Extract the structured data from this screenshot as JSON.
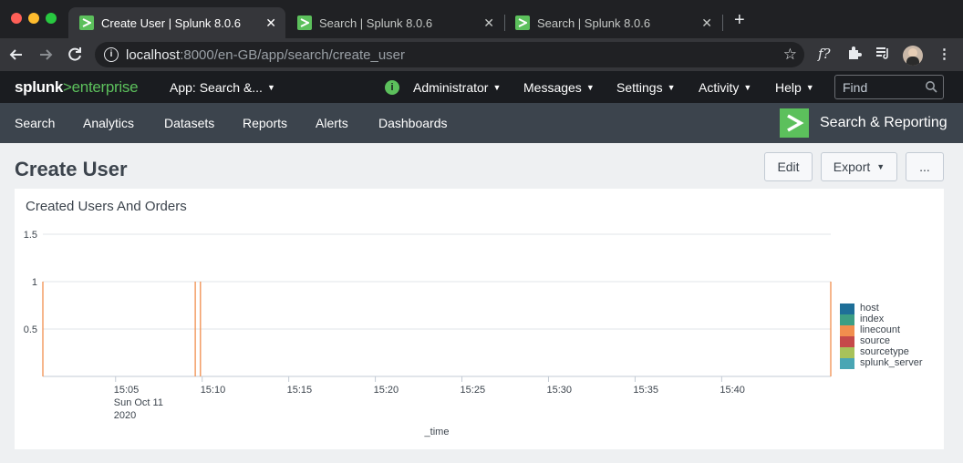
{
  "browser": {
    "tabs": [
      {
        "title": "Create User | Splunk 8.0.6",
        "active": true
      },
      {
        "title": "Search | Splunk 8.0.6",
        "active": false
      },
      {
        "title": "Search | Splunk 8.0.6",
        "active": false
      }
    ],
    "url_host": "localhost",
    "url_path": ":8000/en-GB/app/search/create_user"
  },
  "splunkbar": {
    "logo_main": "splunk",
    "logo_gt": ">",
    "logo_sub": "enterprise",
    "app_menu": "App: Search &...",
    "user_menu": "Administrator",
    "messages": "Messages",
    "settings": "Settings",
    "activity": "Activity",
    "help": "Help",
    "find_placeholder": "Find"
  },
  "appbar": {
    "nav": [
      "Search",
      "Analytics",
      "Datasets",
      "Reports",
      "Alerts",
      "Dashboards"
    ],
    "app_title": "Search & Reporting"
  },
  "page": {
    "title": "Create User",
    "edit_label": "Edit",
    "export_label": "Export",
    "more_label": "..."
  },
  "panel": {
    "title": "Created Users And Orders"
  },
  "chart_data": {
    "type": "line",
    "title": "Created Users And Orders",
    "xlabel": "_time",
    "ylabel": "",
    "ylim": [
      0,
      1.5
    ],
    "yticks": [
      0.5,
      1,
      1.5
    ],
    "xtick_labels": [
      "15:05\nSun Oct 11\n2020",
      "15:10",
      "15:15",
      "15:20",
      "15:25",
      "15:30",
      "15:35",
      "15:40"
    ],
    "x_start_minute": 0.8,
    "x_end_minute": 46.3,
    "x_tick_minutes": [
      5,
      10,
      15,
      20,
      25,
      30,
      35,
      40
    ],
    "grid": true,
    "legend_position": "right",
    "series": [
      {
        "name": "host",
        "color": "#1e6f98",
        "values": []
      },
      {
        "name": "index",
        "color": "#3c9e84",
        "values": []
      },
      {
        "name": "linecount",
        "color": "#f18e4e",
        "values": [
          [
            0.8,
            1
          ],
          [
            9.6,
            1
          ],
          [
            9.9,
            1
          ],
          [
            46.3,
            1
          ]
        ]
      },
      {
        "name": "source",
        "color": "#c54a4a",
        "values": []
      },
      {
        "name": "sourcetype",
        "color": "#a8c25a",
        "values": []
      },
      {
        "name": "splunk_server",
        "color": "#4aa6b4",
        "values": []
      }
    ]
  }
}
